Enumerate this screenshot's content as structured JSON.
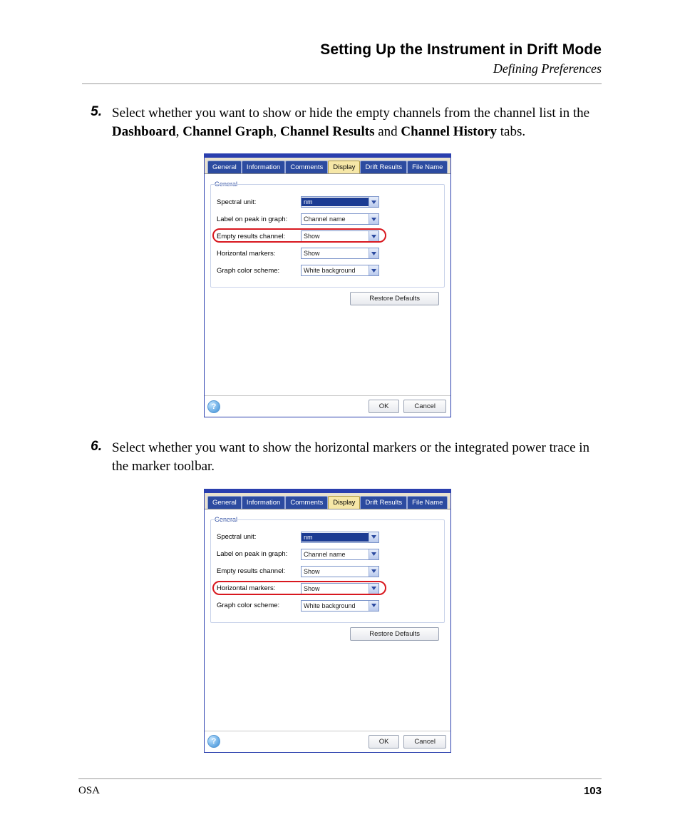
{
  "header": {
    "section_title": "Setting Up the Instrument in Drift Mode",
    "subtitle": "Defining Preferences"
  },
  "steps": {
    "s5": {
      "num": "5.",
      "text_before": "Select whether you want to show or hide the empty channels from the channel list in the ",
      "b1": "Dashboard",
      "sep1": ", ",
      "b2": "Channel Graph",
      "sep2": ", ",
      "b3": "Channel Results",
      "sep3": " and ",
      "b4": "Channel History",
      "text_after": " tabs."
    },
    "s6": {
      "num": "6.",
      "text": "Select whether you want to show the horizontal markers or the integrated power trace in the marker toolbar."
    }
  },
  "dialog": {
    "tabs": [
      "General",
      "Information",
      "Comments",
      "Display",
      "Drift Results",
      "File Name"
    ],
    "active_tab": "Display",
    "fieldset_label": "General",
    "rows": {
      "r1": {
        "label": "Spectral unit:",
        "value": "nm",
        "selected": true
      },
      "r2": {
        "label": "Label on peak in graph:",
        "value": "Channel name",
        "selected": false
      },
      "r3": {
        "label": "Empty results channel:",
        "value": "Show",
        "selected": false
      },
      "r4": {
        "label": "Horizontal markers:",
        "value": "Show",
        "selected": false
      },
      "r5": {
        "label": "Graph color scheme:",
        "value": "White background",
        "selected": false
      }
    },
    "restore": "Restore Defaults",
    "ok": "OK",
    "cancel": "Cancel"
  },
  "footer": {
    "left": "OSA",
    "page": "103"
  }
}
